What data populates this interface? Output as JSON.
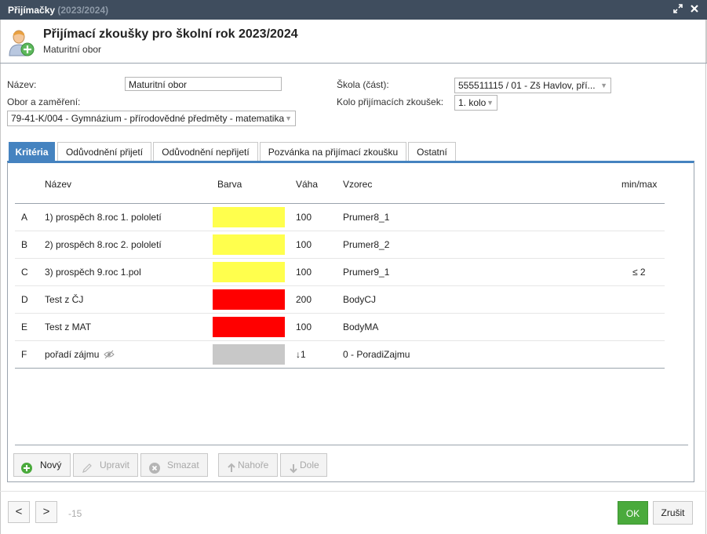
{
  "window": {
    "title": "Přijímačky",
    "title_year": "(2023/2024)"
  },
  "header": {
    "title": "Přijímací zkoušky pro školní rok 2023/2024",
    "subtitle": "Maturitní obor"
  },
  "form": {
    "nazev_label": "Název:",
    "nazev_value": "Maturitní obor",
    "obor_label": "Obor a zaměření:",
    "obor_value": "79-41-K/004 - Gymnázium - přírodovědné předměty - matematika",
    "skola_label": "Škola (část):",
    "skola_value": "555511115 / 01 - Zš Havlov, pří...",
    "kolo_label": "Kolo přijímacích zkoušek:",
    "kolo_value": "1. kolo"
  },
  "tabs": [
    {
      "label": "Kritéria",
      "active": true
    },
    {
      "label": "Odůvodnění přijetí"
    },
    {
      "label": "Odůvodnění nepřijetí"
    },
    {
      "label": "Pozvánka na přijímací zkoušku"
    },
    {
      "label": "Ostatní"
    }
  ],
  "table": {
    "columns": {
      "nazev": "Název",
      "barva": "Barva",
      "vaha": "Váha",
      "vzorec": "Vzorec",
      "minmax": "min/max"
    },
    "rows": [
      {
        "code": "A",
        "name": "1) prospěch 8.roc 1. pololetí",
        "color": "#ffff4d",
        "weight": "100",
        "formula": "Prumer8_1",
        "minmax": ""
      },
      {
        "code": "B",
        "name": "2) prospěch 8.roc 2. pololetí",
        "color": "#ffff4d",
        "weight": "100",
        "formula": "Prumer8_2",
        "minmax": ""
      },
      {
        "code": "C",
        "name": "3) prospěch 9.roc 1.pol",
        "color": "#ffff4d",
        "weight": "100",
        "formula": "Prumer9_1",
        "minmax": "≤ 2"
      },
      {
        "code": "D",
        "name": "Test z ČJ",
        "color": "#ff0000",
        "weight": "200",
        "formula": "BodyCJ",
        "minmax": ""
      },
      {
        "code": "E",
        "name": "Test z MAT",
        "color": "#ff0000",
        "weight": "100",
        "formula": "BodyMA",
        "minmax": ""
      },
      {
        "code": "F",
        "name": "pořadí zájmu",
        "color": "#c8c8c8",
        "weight": "↓1",
        "formula": "0 - PoradiZajmu",
        "minmax": "",
        "icon": "eye-slash-icon"
      }
    ]
  },
  "toolbar": {
    "novy": "Nový",
    "upravit": "Upravit",
    "smazat": "Smazat",
    "nahore": "Nahoře",
    "dole": "Dole"
  },
  "footer": {
    "prev": "<",
    "next": ">",
    "counter": "-15",
    "ok": "OK",
    "cancel": "Zrušit"
  },
  "colors": {
    "titlebar": "#3f4d5e",
    "accent": "#4583c0",
    "ok": "#4aaa3c"
  }
}
